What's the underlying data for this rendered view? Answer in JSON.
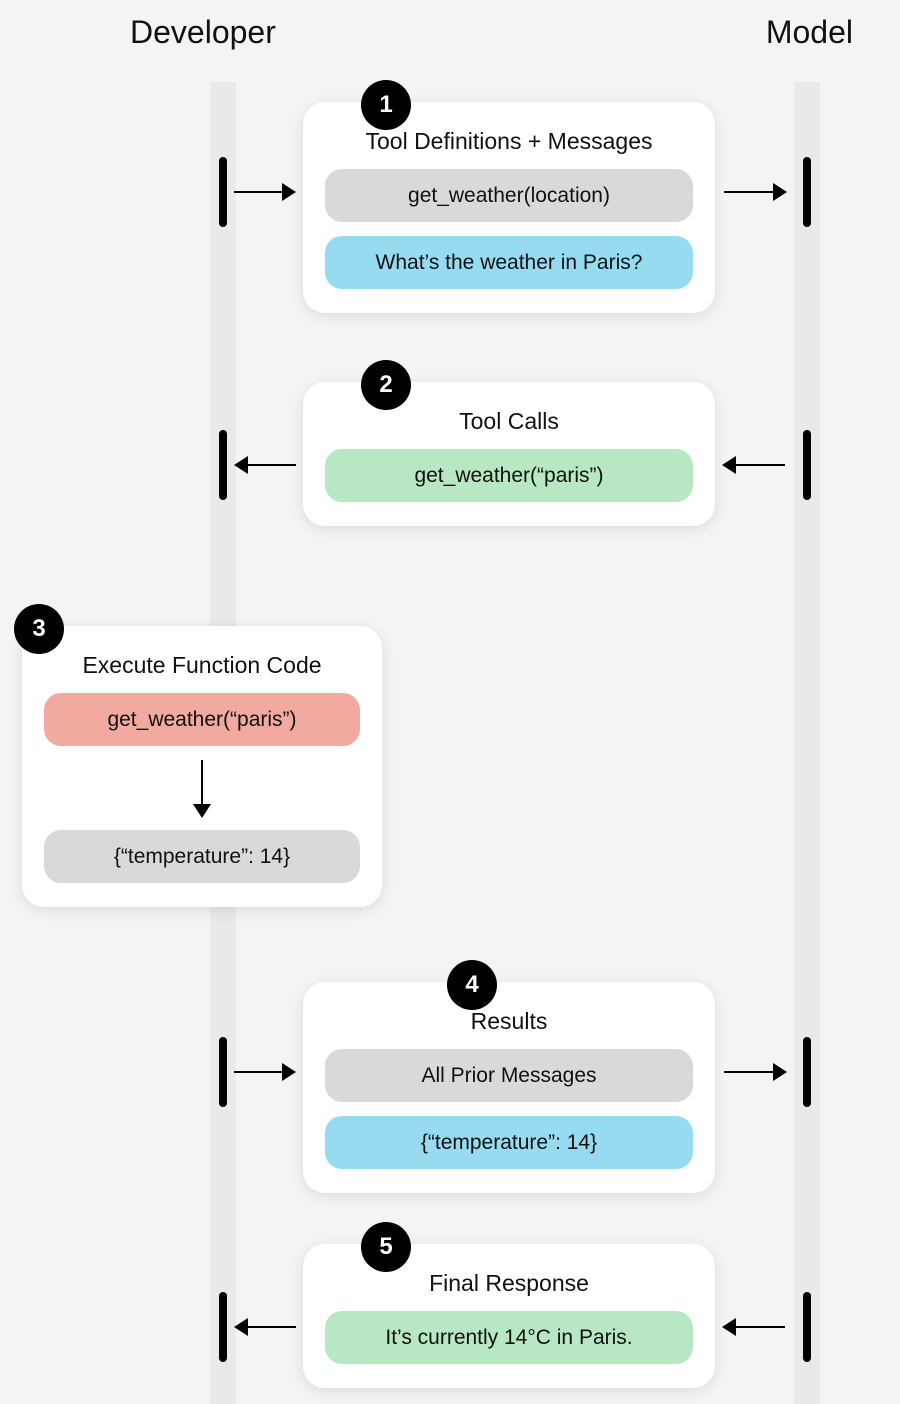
{
  "columns": {
    "developer_label": "Developer",
    "model_label": "Model"
  },
  "steps": {
    "s1": {
      "badge": "1",
      "title": "Tool Definitions + Messages",
      "pill_gray": "get_weather(location)",
      "pill_blue": "What’s the weather in Paris?"
    },
    "s2": {
      "badge": "2",
      "title": "Tool Calls",
      "pill_green": "get_weather(“paris”)"
    },
    "s3": {
      "badge": "3",
      "title": "Execute Function Code",
      "pill_red": "get_weather(“paris”)",
      "pill_gray": "{“temperature”: 14}"
    },
    "s4": {
      "badge": "4",
      "title": "Results",
      "pill_gray": "All Prior Messages",
      "pill_blue": "{“temperature”: 14}"
    },
    "s5": {
      "badge": "5",
      "title": "Final Response",
      "pill_green": "It’s currently 14°C in Paris."
    }
  }
}
